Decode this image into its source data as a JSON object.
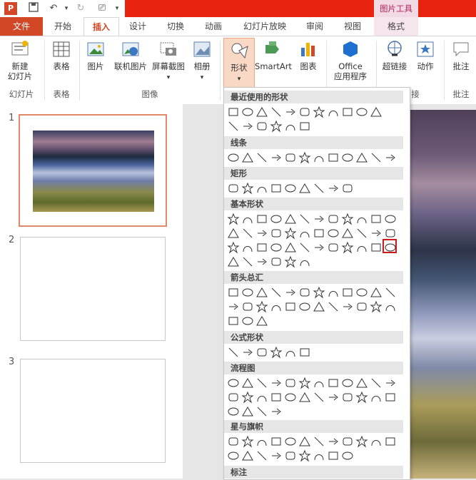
{
  "titlebar": {
    "app_icon": "P",
    "undo_icon": "undo-icon",
    "picture_tools": "图片工具"
  },
  "tabs": {
    "file": "文件",
    "home": "开始",
    "insert": "插入",
    "design": "设计",
    "transitions": "切换",
    "animations": "动画",
    "slideshow": "幻灯片放映",
    "review": "审阅",
    "view": "视图",
    "format": "格式"
  },
  "ribbon": {
    "new_slide": "新建\n幻灯片",
    "table": "表格",
    "picture": "图片",
    "online_picture": "联机图片",
    "screenshot": "屏幕截图",
    "album": "相册",
    "shapes": "形状",
    "smartart": "SmartArt",
    "chart": "图表",
    "office_apps": "Office\n应用程序",
    "hyperlink": "超链接",
    "action": "动作",
    "comment": "批注",
    "groups": {
      "slides": "幻灯片",
      "tables": "表格",
      "images": "图像",
      "links": "接",
      "comments": "批注"
    }
  },
  "slides": {
    "numbers": [
      "1",
      "2",
      "3"
    ]
  },
  "menu": {
    "sections": [
      "最近使用的形状",
      "线条",
      "矩形",
      "基本形状",
      "箭头总汇",
      "公式形状",
      "流程图",
      "星与旗帜",
      "标注"
    ]
  },
  "colors": {
    "accent": "#d24726",
    "titlebar_red": "#e8230f",
    "selection_red": "#d01a1a"
  }
}
